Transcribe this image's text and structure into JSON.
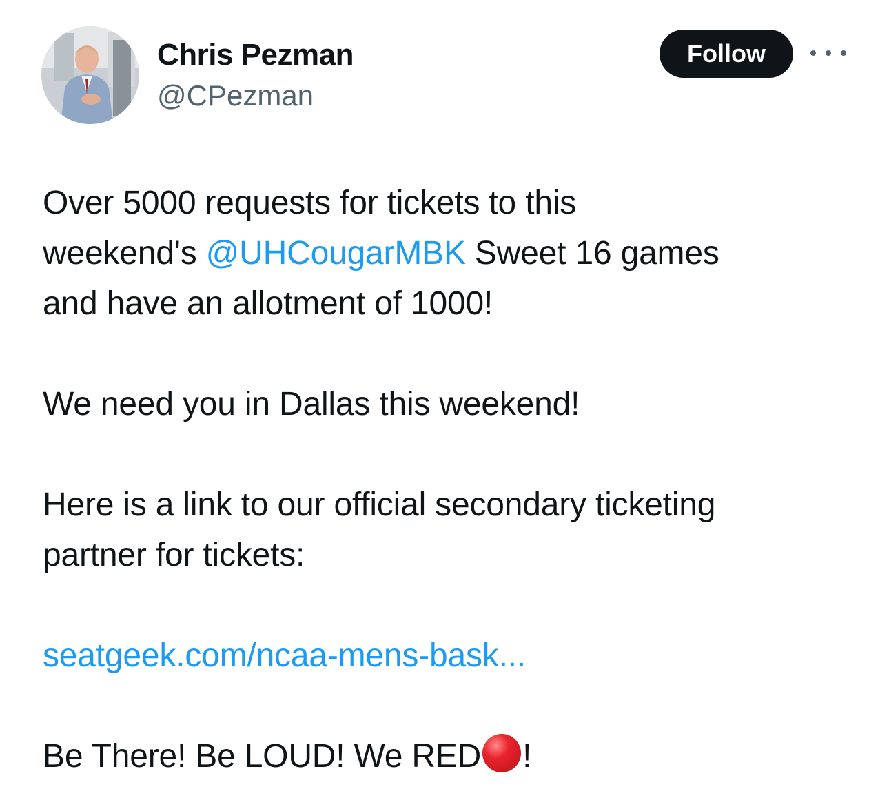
{
  "author": {
    "name": "Chris Pezman",
    "handle": "@CPezman",
    "avatar_icon": "profile-photo"
  },
  "actions": {
    "follow_label": "Follow",
    "more_icon": "more-dots-icon"
  },
  "tweet": {
    "line1": "Over 5000 requests for tickets to this",
    "line2_pre": "weekend's ",
    "mention": "@UHCougarMBK",
    "line2_post": " Sweet 16 games",
    "line3": "and have an allotment of 1000!",
    "para2": "We need you in Dallas this weekend!",
    "para3_line1": "Here is a link to our official secondary ticketing",
    "para3_line2": "partner for tickets:",
    "url": "seatgeek.com/ncaa-mens-bask...",
    "para5_pre": "Be There!  Be LOUD!  We RED",
    "para5_post": "!",
    "emoji": "red-circle-emoji"
  },
  "colors": {
    "link": "#1d9bf0",
    "button_bg": "#0f1419",
    "secondary_text": "#536471"
  }
}
